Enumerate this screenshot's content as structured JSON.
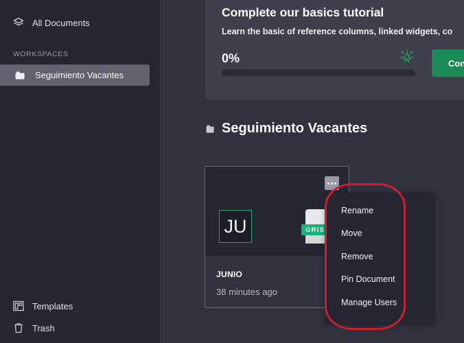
{
  "sidebar": {
    "all_documents": "All Documents",
    "workspaces_heading": "WORKSPACES",
    "workspace_item": "Seguimiento Vacantes",
    "templates": "Templates",
    "trash": "Trash",
    "icons": [
      "layers-icon",
      "folder-icon",
      "templates-icon",
      "trash-icon"
    ]
  },
  "tutorial": {
    "title": "Complete our basics tutorial",
    "description": "Learn the basic of reference columns, linked widgets, co",
    "progress_text": "0%",
    "progress_fraction": 0,
    "button_label": "Con"
  },
  "workspace": {
    "title": "Seguimiento Vacantes"
  },
  "document": {
    "initials": "JU",
    "logo_text": "GRIS",
    "name": "JUNIO",
    "modified": "38 minutes ago"
  },
  "context_menu": {
    "items": [
      "Rename",
      "Move",
      "Remove",
      "Pin Document",
      "Manage Users"
    ]
  },
  "colors": {
    "accent_green": "#1a8a57",
    "annotation_red": "#cc1f2e",
    "sidebar_bg": "#262633",
    "main_bg": "#32323f"
  }
}
